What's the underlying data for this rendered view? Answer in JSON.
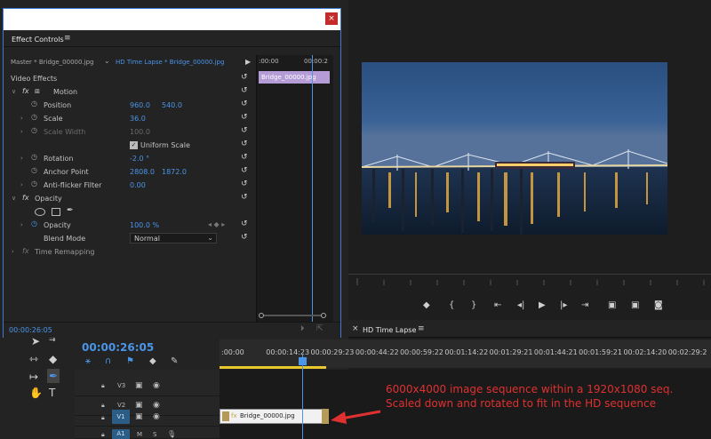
{
  "effect_controls": {
    "panel_title": "Effect Controls",
    "menu_icon": "hamburger-icon",
    "source_master": "Master * Bridge_00000.jpg",
    "source_sequence": "HD Time Lapse * Bridge_00000.jpg",
    "mini_ruler_start": ":00:00",
    "mini_ruler_end": "00:00:2",
    "mini_clip_label": "Bridge_00000.jpg",
    "footer_timecode": "00:00:26:05",
    "sections": {
      "video_effects": "Video Effects",
      "motion": "Motion",
      "opacity": "Opacity",
      "time_remapping": "Time Remapping"
    },
    "motion": {
      "position_label": "Position",
      "position_x": "960.0",
      "position_y": "540.0",
      "scale_label": "Scale",
      "scale_value": "36.0",
      "scale_width_label": "Scale Width",
      "scale_width_value": "100.0",
      "uniform_scale_label": "Uniform Scale",
      "rotation_label": "Rotation",
      "rotation_value": "-2.0 °",
      "anchor_label": "Anchor Point",
      "anchor_x": "2808.0",
      "anchor_y": "1872.0",
      "antiflicker_label": "Anti-flicker Filter",
      "antiflicker_value": "0.00"
    },
    "opacity": {
      "opacity_label": "Opacity",
      "opacity_value": "100.0 %",
      "blend_label": "Blend Mode",
      "blend_value": "Normal"
    }
  },
  "timeline": {
    "tab_label": "HD Time Lapse",
    "current_time": "00:00:26:05",
    "ruler_ticks": [
      ":00:00",
      "00:00:14:23",
      "00:00:29:23",
      "00:00:44:22",
      "00:00:59:22",
      "00:01:14:22",
      "00:01:29:21",
      "00:01:44:21",
      "00:01:59:21",
      "00:02:14:20",
      "00:02:29:2"
    ],
    "tracks": [
      {
        "name": "V3"
      },
      {
        "name": "V2"
      },
      {
        "name": "V1"
      },
      {
        "name": "A1"
      }
    ],
    "clip_label": "Bridge_00000.jpg",
    "track_m": "M",
    "track_s": "S"
  },
  "annotation": {
    "line1": "6000x4000 image sequence within a 1920x1080 seq.",
    "line2": "Scaled down and rotated to fit in the HD sequence",
    "color": "#e03030"
  },
  "colors": {
    "accent_blue": "#4a95e8",
    "clip_purple": "#b59cd6",
    "close_red": "#c42b2b"
  }
}
